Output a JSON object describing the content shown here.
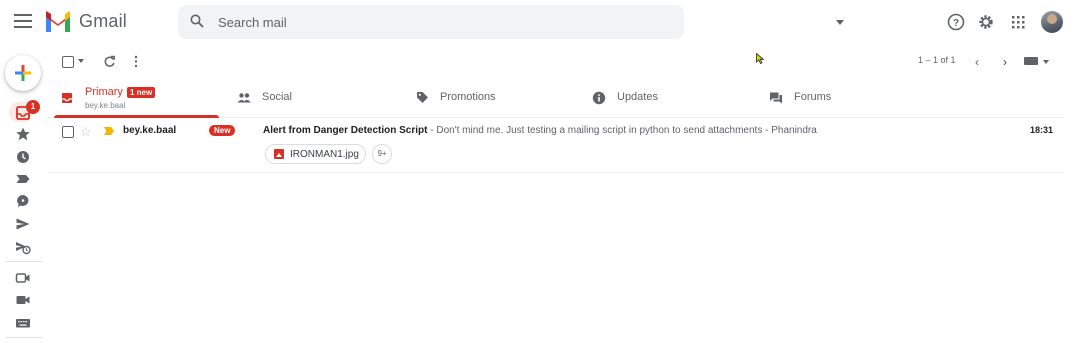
{
  "app": {
    "brand": "Gmail"
  },
  "search": {
    "placeholder": "Search mail"
  },
  "header_icons": [
    "menu-icon",
    "help-icon",
    "settings-icon",
    "apps-icon",
    "avatar"
  ],
  "rail": {
    "inbox_badge": "1",
    "items": [
      "inbox-icon",
      "star-icon",
      "clock-icon",
      "label-icon",
      "chat-icon",
      "send-icon",
      "scheduled-icon",
      "meet-new-icon",
      "video-icon",
      "keyboard-icon"
    ]
  },
  "toolbar": {
    "pager": "1 – 1 of 1"
  },
  "tabs": [
    {
      "label": "Primary",
      "sub": "bey.ke.baal",
      "badge": "1 new",
      "icon": "inbox-icon",
      "active": true
    },
    {
      "label": "Social",
      "icon": "people-icon"
    },
    {
      "label": "Promotions",
      "icon": "tag-icon"
    },
    {
      "label": "Updates",
      "icon": "info-icon"
    },
    {
      "label": "Forums",
      "icon": "forum-icon"
    }
  ],
  "emails": [
    {
      "sender": "bey.ke.baal",
      "badge": "New",
      "subject": "Alert from Danger Detection Script",
      "snippet": " - Don't mind me. Just testing a mailing script in python to send attachments - Phanindra",
      "time": "18:31",
      "attachment": "IRONMAN1.jpg",
      "more": "9+"
    }
  ],
  "colors": {
    "accent": "#d93025",
    "important": "#f4b400",
    "search_bg": "#f1f3f4"
  }
}
